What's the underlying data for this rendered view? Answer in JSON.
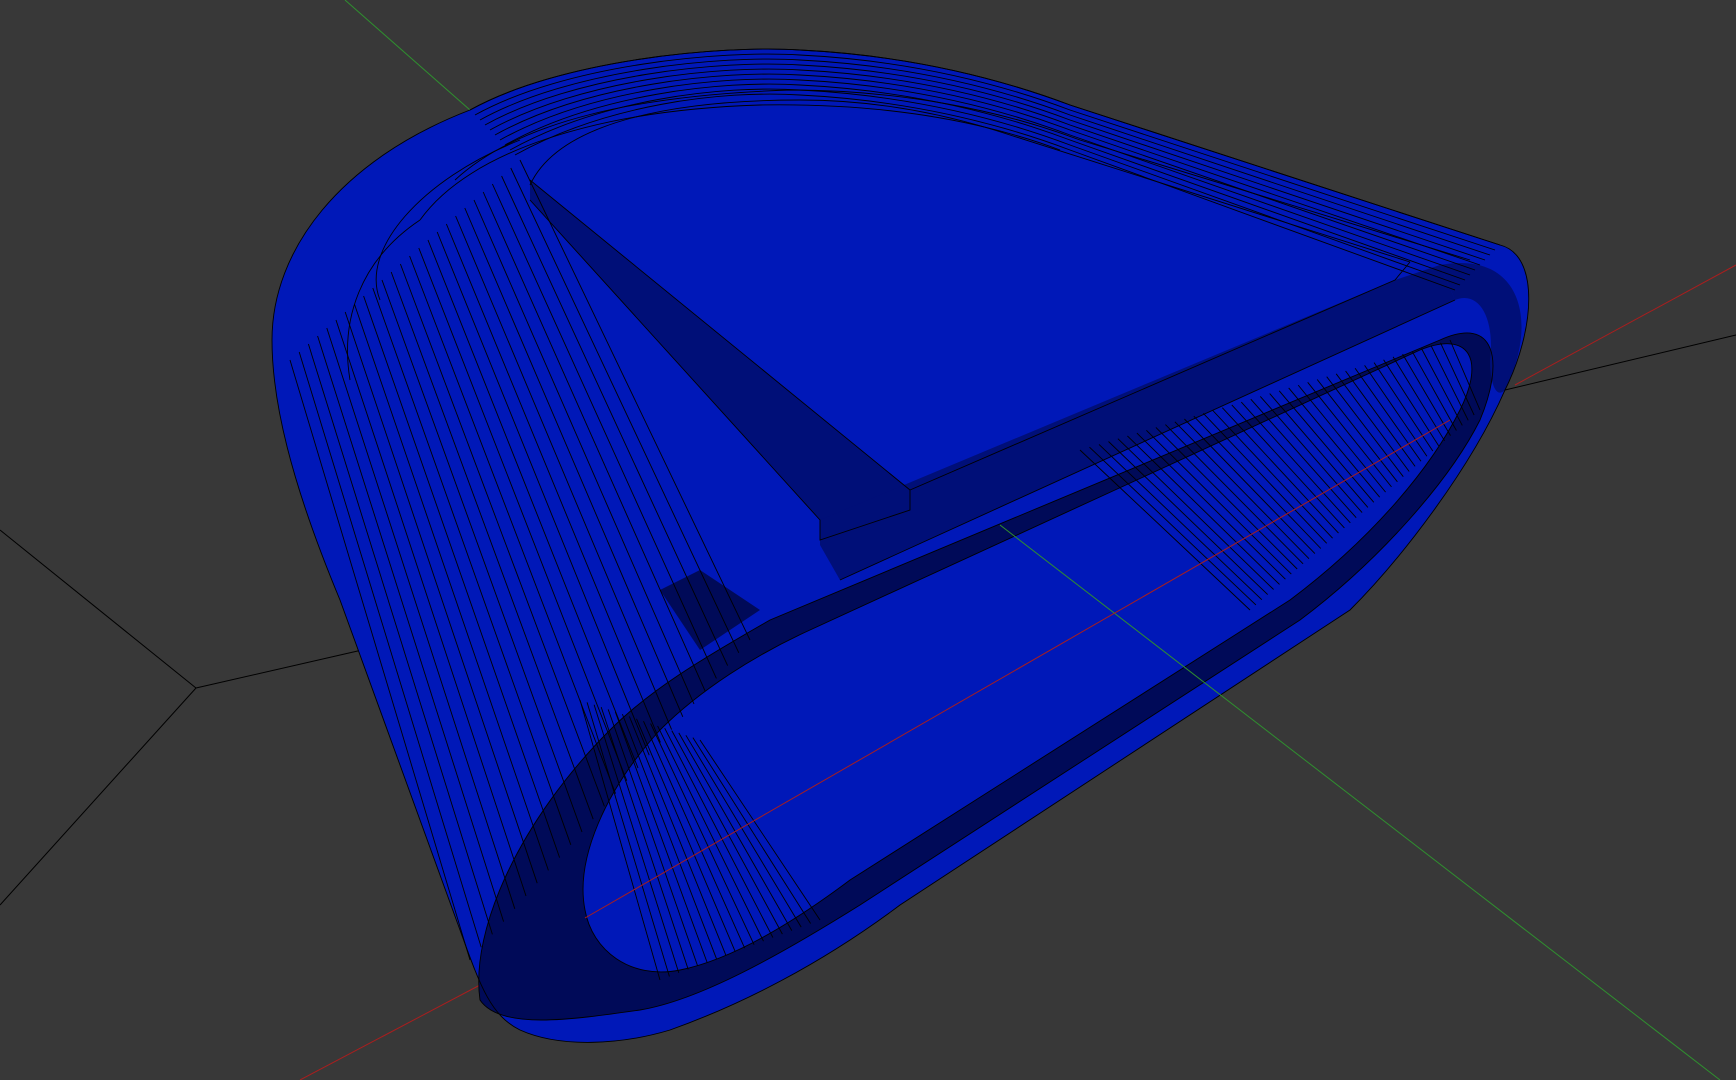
{
  "viewport": {
    "background": "#383838",
    "shading_mode": "wireframe-overlay",
    "render_style": "solid-with-edges"
  },
  "model": {
    "color": "#0018b8",
    "color_shadow": "#000f78",
    "color_dark": "#000a58",
    "edge_color": "#000000"
  },
  "axes": {
    "x_color": "#a81e1e",
    "y_color": "#2f8f2f",
    "z_color": "#000000"
  },
  "grid": {
    "visible": false
  }
}
